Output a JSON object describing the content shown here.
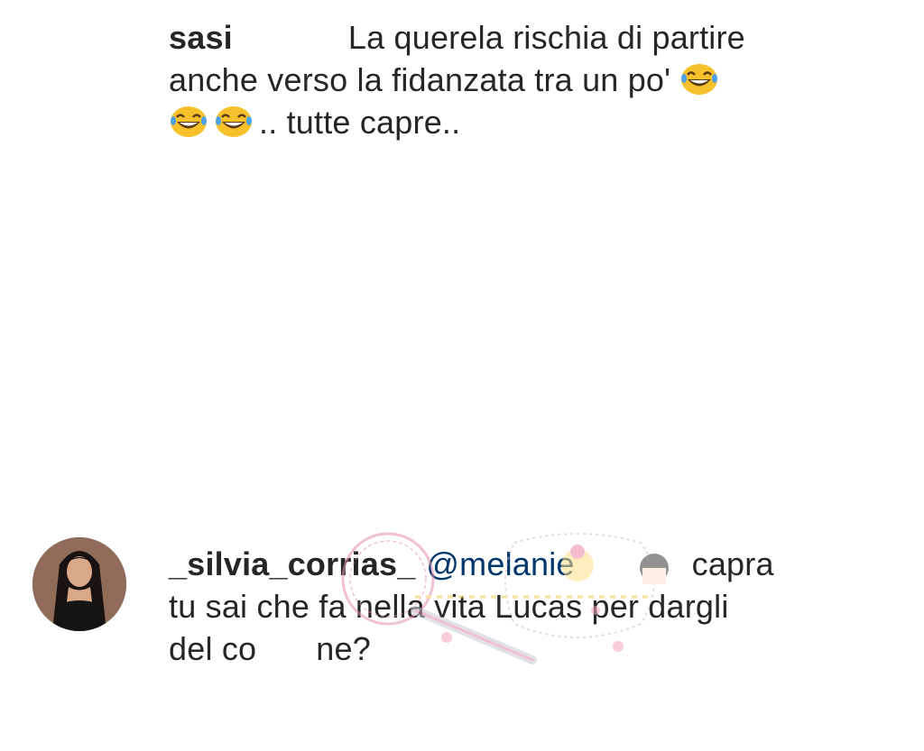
{
  "comments": [
    {
      "username": "sasi",
      "text_line1": "La querela rischia di partire",
      "text_line2": "anche verso la fidanzata tra un po'",
      "text_line3": ".. tutte capre.."
    },
    {
      "username": "_silvia_corrias_",
      "mention": "@melanie",
      "text_line1_end": "capra",
      "text_line2": "tu sai che fa nella vita Lucas per dargli",
      "text_line3_start": "del co",
      "text_line3_end": "ne?"
    }
  ],
  "icons": {
    "laughing_emoji": "face-with-tears-of-joy-icon",
    "avatar": "user-avatar",
    "watermark": "watermark-logo"
  },
  "colors": {
    "text": "#262626",
    "mention": "#00376b",
    "emoji_face": "#f7c12b",
    "background": "#ffffff"
  }
}
